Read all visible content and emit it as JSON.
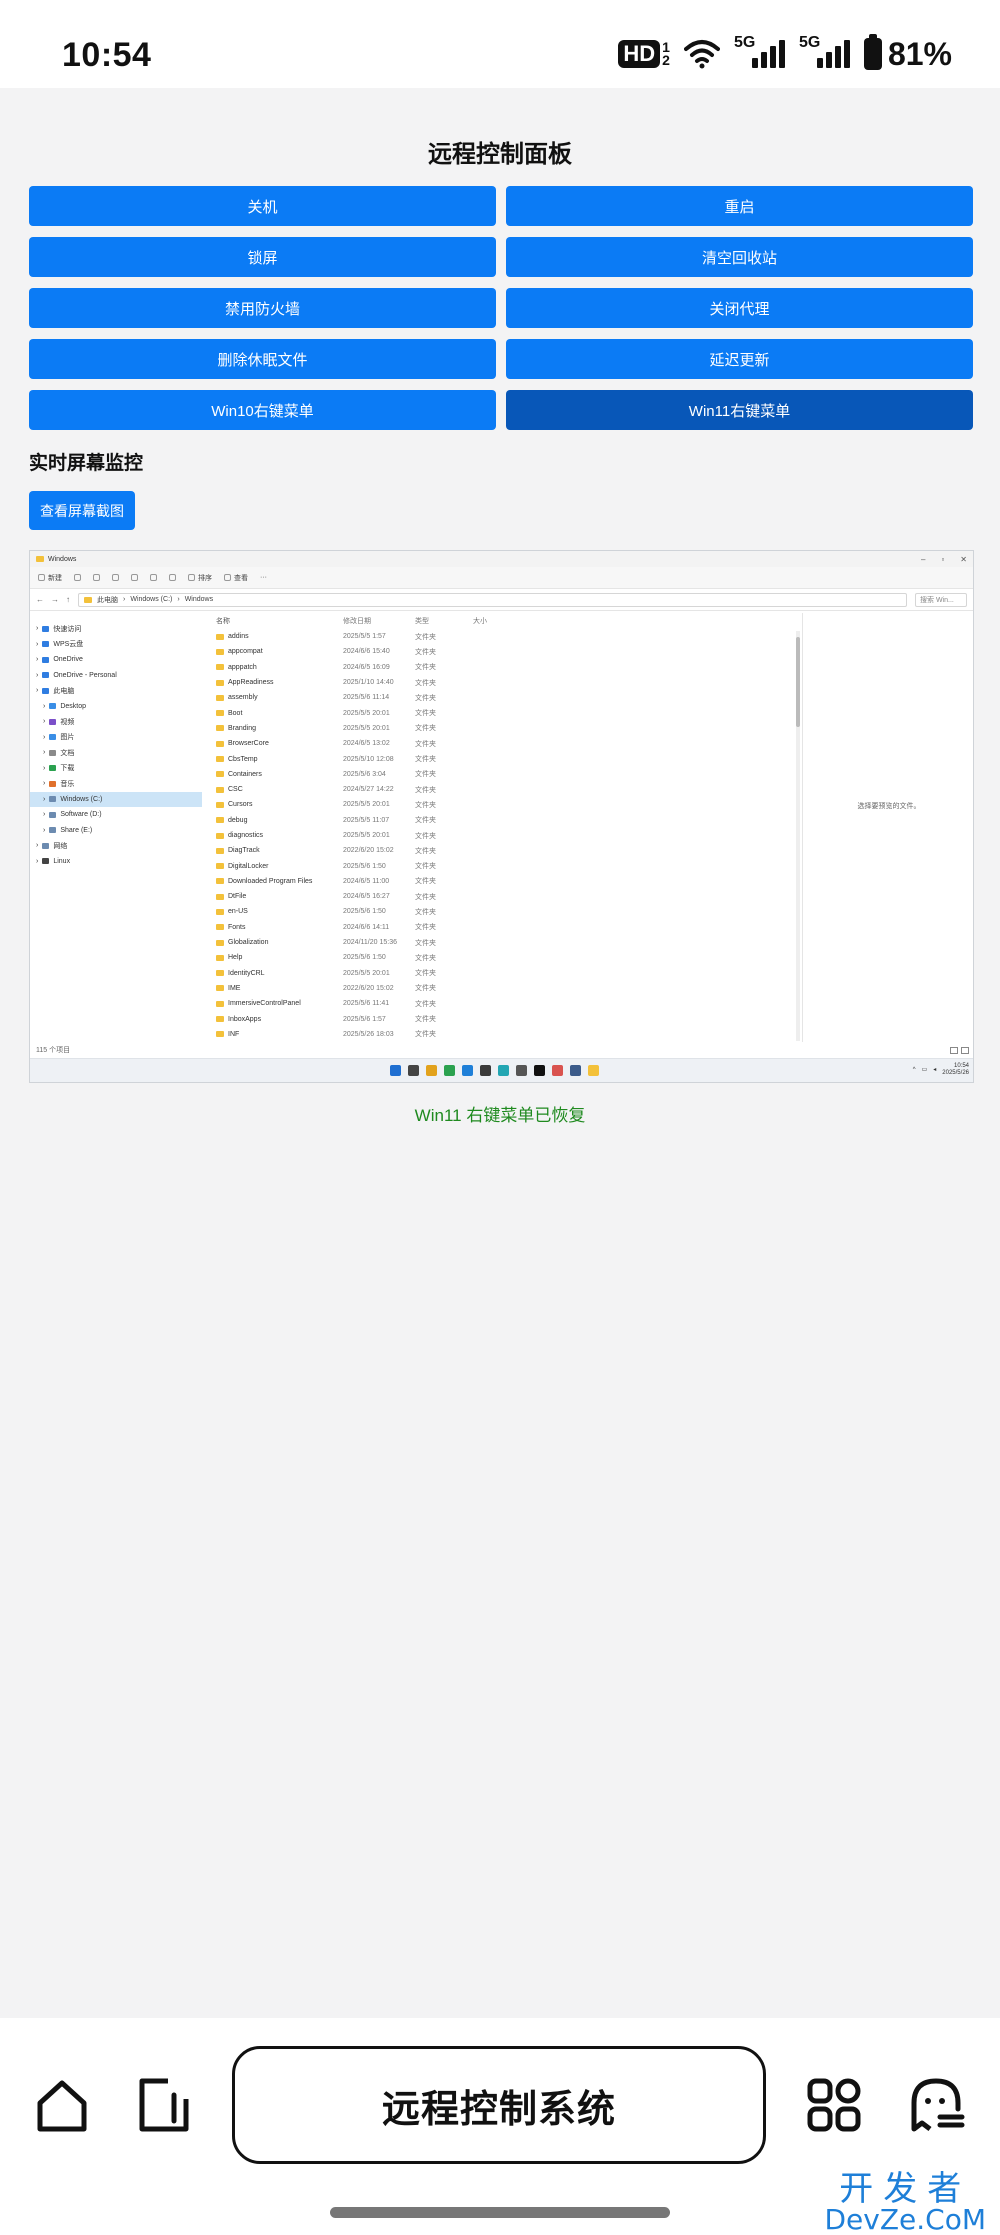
{
  "status_bar": {
    "time": "10:54",
    "hd_label": "HD",
    "hd_sub_top": "1",
    "hd_sub_bottom": "2",
    "signal_1": "5G",
    "signal_2": "5G",
    "battery": "81%"
  },
  "panel": {
    "title": "远程控制面板",
    "buttons": [
      {
        "label": "关机"
      },
      {
        "label": "重启"
      },
      {
        "label": "锁屏"
      },
      {
        "label": "清空回收站"
      },
      {
        "label": "禁用防火墙"
      },
      {
        "label": "关闭代理"
      },
      {
        "label": "删除休眠文件"
      },
      {
        "label": "延迟更新"
      },
      {
        "label": "Win10右键菜单"
      },
      {
        "label": "Win11右键菜单"
      }
    ],
    "monitor_title": "实时屏幕监控",
    "screenshot_button": "查看屏幕截图",
    "status_message": "Win11 右键菜单已恢复"
  },
  "screenshot": {
    "window_title": "Windows",
    "toolbar": {
      "new": "新建",
      "sort": "排序",
      "view": "查看",
      "more": "···"
    },
    "address": {
      "root": "此电脑",
      "drive": "Windows (C:)",
      "folder": "Windows"
    },
    "search_placeholder": "搜索 Win...",
    "columns": {
      "name": "名称",
      "date": "修改日期",
      "type": "类型",
      "size": "大小"
    },
    "nav_items": [
      {
        "label": "快速访问",
        "sub": false,
        "selected": false,
        "color": "#2f7de1"
      },
      {
        "label": "WPS云盘",
        "sub": false,
        "selected": false,
        "color": "#2f7de1"
      },
      {
        "label": "OneDrive",
        "sub": false,
        "selected": false,
        "color": "#2f7de1"
      },
      {
        "label": "OneDrive - Personal",
        "sub": false,
        "selected": false,
        "color": "#2f7de1"
      },
      {
        "label": "此电脑",
        "sub": false,
        "selected": false,
        "color": "#2f7de1"
      },
      {
        "label": "Desktop",
        "sub": true,
        "selected": false,
        "color": "#3a8ee6"
      },
      {
        "label": "视频",
        "sub": true,
        "selected": false,
        "color": "#7b4fc9"
      },
      {
        "label": "图片",
        "sub": true,
        "selected": false,
        "color": "#3a8ee6"
      },
      {
        "label": "文档",
        "sub": true,
        "selected": false,
        "color": "#8a8a8a"
      },
      {
        "label": "下载",
        "sub": true,
        "selected": false,
        "color": "#2aa14f"
      },
      {
        "label": "音乐",
        "sub": true,
        "selected": false,
        "color": "#e0702b"
      },
      {
        "label": "Windows (C:)",
        "sub": true,
        "selected": true,
        "color": "#6c8bb0"
      },
      {
        "label": "Software (D:)",
        "sub": true,
        "selected": false,
        "color": "#6c8bb0"
      },
      {
        "label": "Share (E:)",
        "sub": true,
        "selected": false,
        "color": "#6c8bb0"
      },
      {
        "label": "网络",
        "sub": false,
        "selected": false,
        "color": "#6c8bb0"
      },
      {
        "label": "Linux",
        "sub": false,
        "selected": false,
        "color": "#444444"
      }
    ],
    "files": [
      {
        "name": "addins",
        "date": "2025/5/5 1:57",
        "type": "文件夹"
      },
      {
        "name": "appcompat",
        "date": "2024/6/6 15:40",
        "type": "文件夹"
      },
      {
        "name": "apppatch",
        "date": "2024/6/5 16:09",
        "type": "文件夹"
      },
      {
        "name": "AppReadiness",
        "date": "2025/1/10 14:40",
        "type": "文件夹"
      },
      {
        "name": "assembly",
        "date": "2025/5/6 11:14",
        "type": "文件夹"
      },
      {
        "name": "Boot",
        "date": "2025/5/5 20:01",
        "type": "文件夹"
      },
      {
        "name": "Branding",
        "date": "2025/5/5 20:01",
        "type": "文件夹"
      },
      {
        "name": "BrowserCore",
        "date": "2024/6/5 13:02",
        "type": "文件夹"
      },
      {
        "name": "CbsTemp",
        "date": "2025/5/10 12:08",
        "type": "文件夹"
      },
      {
        "name": "Containers",
        "date": "2025/5/6 3:04",
        "type": "文件夹"
      },
      {
        "name": "CSC",
        "date": "2024/5/27 14:22",
        "type": "文件夹"
      },
      {
        "name": "Cursors",
        "date": "2025/5/5 20:01",
        "type": "文件夹"
      },
      {
        "name": "debug",
        "date": "2025/5/5 11:07",
        "type": "文件夹"
      },
      {
        "name": "diagnostics",
        "date": "2025/5/5 20:01",
        "type": "文件夹"
      },
      {
        "name": "DiagTrack",
        "date": "2022/6/20 15:02",
        "type": "文件夹"
      },
      {
        "name": "DigitalLocker",
        "date": "2025/5/6 1:50",
        "type": "文件夹"
      },
      {
        "name": "Downloaded Program Files",
        "date": "2024/6/5 11:00",
        "type": "文件夹"
      },
      {
        "name": "DtFile",
        "date": "2024/6/5 16:27",
        "type": "文件夹"
      },
      {
        "name": "en-US",
        "date": "2025/5/6 1:50",
        "type": "文件夹"
      },
      {
        "name": "Fonts",
        "date": "2024/6/6 14:11",
        "type": "文件夹"
      },
      {
        "name": "Globalization",
        "date": "2024/11/20 15:36",
        "type": "文件夹"
      },
      {
        "name": "Help",
        "date": "2025/5/6 1:50",
        "type": "文件夹"
      },
      {
        "name": "IdentityCRL",
        "date": "2025/5/5 20:01",
        "type": "文件夹"
      },
      {
        "name": "IME",
        "date": "2022/6/20 15:02",
        "type": "文件夹"
      },
      {
        "name": "ImmersiveControlPanel",
        "date": "2025/5/6 11:41",
        "type": "文件夹"
      },
      {
        "name": "InboxApps",
        "date": "2025/5/6 1:57",
        "type": "文件夹"
      },
      {
        "name": "INF",
        "date": "2025/5/26 18:03",
        "type": "文件夹"
      }
    ],
    "preview_text": "选择要预览的文件。",
    "item_count": "115 个项目",
    "tray_time": "10:54",
    "tray_date": "2025/5/26",
    "taskbar_colors": [
      "#1f6fd1",
      "#444444",
      "#e2a21c",
      "#2aa14f",
      "#1e7fd8",
      "#3a3a3a",
      "#22a6b3",
      "#555555",
      "#111111",
      "#d9534f",
      "#3b5b8a",
      "#f3c13a"
    ]
  },
  "bottom_bar": {
    "title": "远程控制系统",
    "watermark_cn": "开发者",
    "watermark_en": "DevZe.CoM"
  }
}
